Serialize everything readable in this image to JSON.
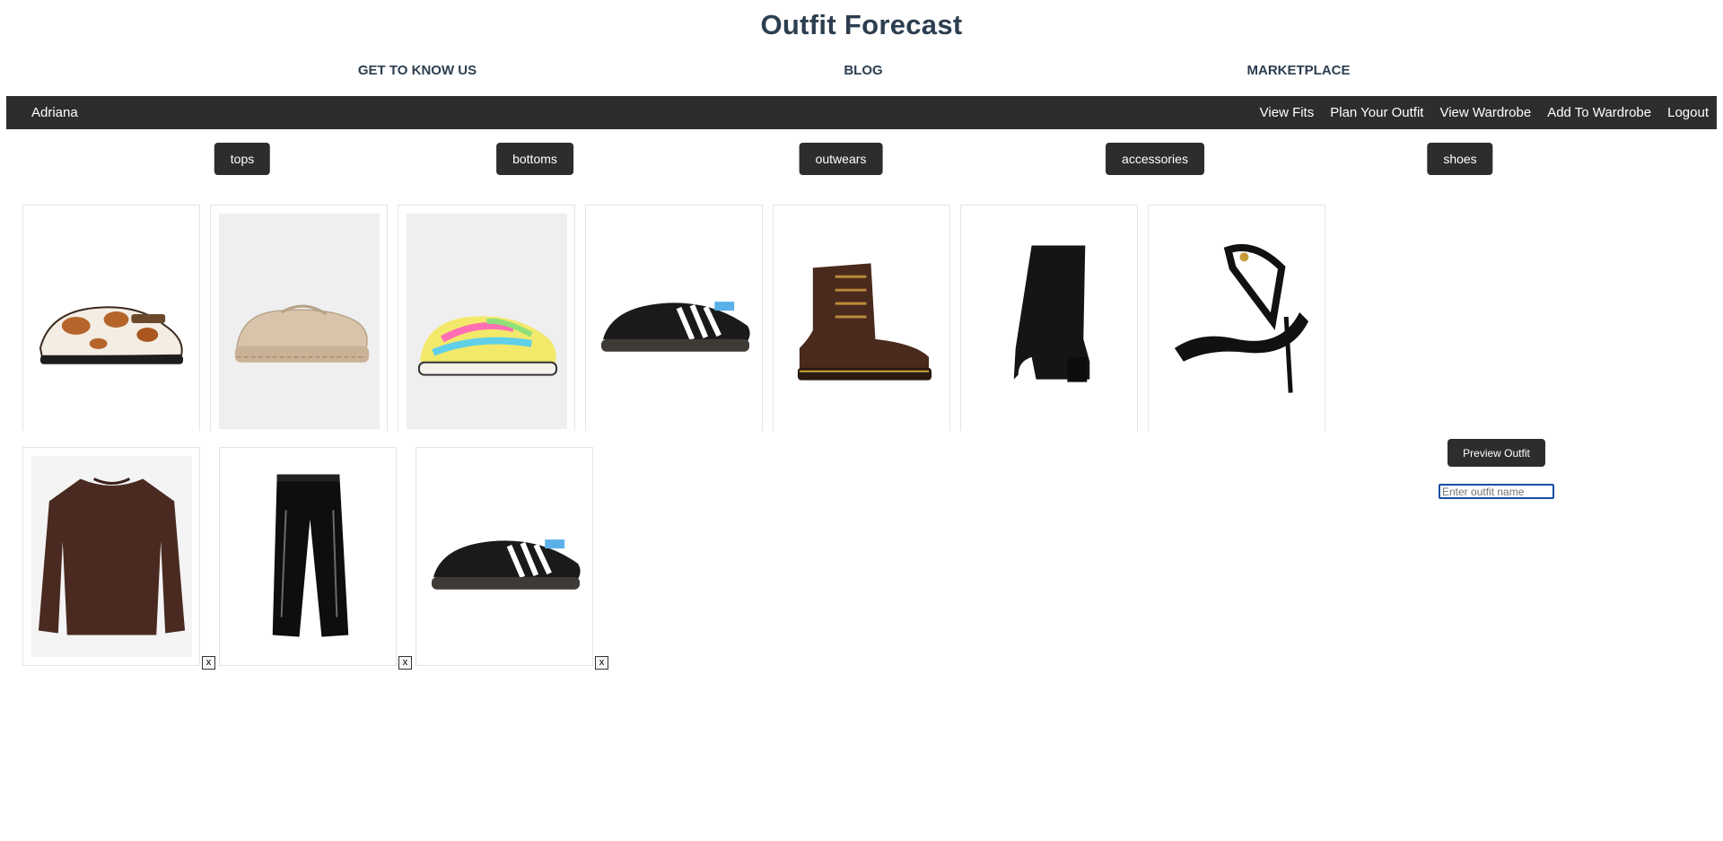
{
  "site": {
    "title": "Outfit Forecast"
  },
  "topnav": {
    "links": [
      "GET TO KNOW US",
      "BLOG",
      "MARKETPLACE"
    ]
  },
  "userbar": {
    "username": "Adriana",
    "links": [
      "View Fits",
      "Plan Your Outfit",
      "View Wardrobe",
      "Add To Wardrobe",
      "Logout"
    ]
  },
  "categories": [
    "tops",
    "bottoms",
    "outwears",
    "accessories",
    "shoes"
  ],
  "wardrobe_items": [
    {
      "icon": "cow-print-clog-icon"
    },
    {
      "icon": "beige-loafer-icon"
    },
    {
      "icon": "rainbow-knit-sneaker-icon"
    },
    {
      "icon": "black-samba-sneaker-icon"
    },
    {
      "icon": "brown-lace-up-boot-icon"
    },
    {
      "icon": "black-knee-boot-icon"
    },
    {
      "icon": "black-strappy-heel-icon"
    }
  ],
  "selected_outfit": {
    "items": [
      {
        "icon": "brown-sweatshirt-icon",
        "remove_label": "x"
      },
      {
        "icon": "black-vinyl-pants-icon",
        "remove_label": "x"
      },
      {
        "icon": "black-samba-sneaker-icon",
        "remove_label": "x"
      }
    ],
    "preview_label": "Preview Outfit",
    "name_placeholder": "Enter outfit name",
    "name_value": ""
  }
}
